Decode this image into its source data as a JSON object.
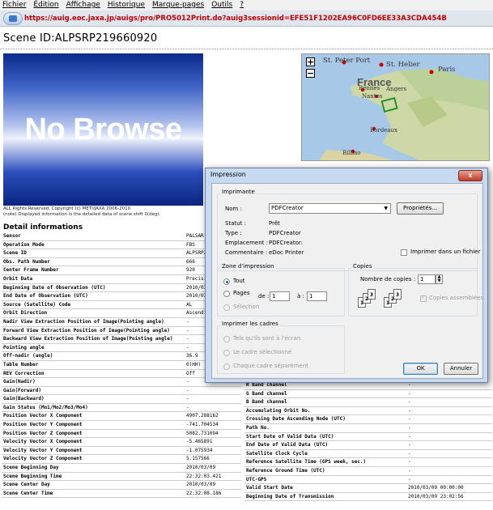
{
  "menu": [
    "Fichier",
    "Édition",
    "Affichage",
    "Historique",
    "Marque-pages",
    "Outils",
    "?"
  ],
  "url": "https://auig.eoc.jaxa.jp/auigs/pro/PRO5012Print.do?auig3sessionid=EFE51F1202EA96C0FD6EE33A3CDA454B",
  "scene_title": "Scene ID:ALPSRP219660920",
  "browse_text": "No Browse",
  "copyright": [
    "ALL Rights Reserved, Copyright (c) METI/JAXA 2006-2010",
    "(note) Displayed information is the detailed data of scene shift 0(deg)."
  ],
  "detail_heading": "Detail informations",
  "left_rows": [
    [
      "Sensor",
      "PALSAR"
    ],
    [
      "Operation Mode",
      "FBS"
    ],
    [
      "Scene ID",
      "ALPSRP2"
    ],
    [
      "Obs. Path Number",
      "666"
    ],
    [
      "Center Frame Number",
      "920"
    ],
    [
      "Orbit Data",
      "Precisi"
    ],
    [
      "Beginning Date of Observation (UTC)",
      "2010/03/"
    ],
    [
      "End Date of Observation (UTC)",
      "2010/03/"
    ],
    [
      "Source (Satellite) Code",
      "AL"
    ],
    [
      "Orbit Direction",
      "Ascendi"
    ],
    [
      "Nadir View Extraction Position of Image(Pointing angle)",
      "-"
    ],
    [
      "Forward View Extraction Position of Image(Pointing angle)",
      "-"
    ],
    [
      "Backward View Extraction Position of Image(Pointing angle)",
      "-"
    ],
    [
      "Pointing angle",
      "-"
    ],
    [
      "Off-nadir (angle)",
      "36.9"
    ],
    [
      "Table Number",
      "0(HH)"
    ],
    [
      "REV Correction",
      "Off"
    ],
    [
      "Gain(Nadir)",
      "-"
    ],
    [
      "Gain(Forward)",
      "-"
    ],
    [
      "Gain(Backward)",
      "-"
    ],
    [
      "Gain Status (Mo1/Mo2/Mo3/Mo4)",
      "-"
    ],
    [
      "Position Vector X Component",
      "4907.288162"
    ],
    [
      "Position Vector Y Component",
      "-741.704534"
    ],
    [
      "Position Vector Z Component",
      "5082.731094"
    ],
    [
      "Velocity Vector X Component",
      "-5.465891"
    ],
    [
      "Velocity Vector Y Component",
      "-1.075934"
    ],
    [
      "Velocity Vector Z Component",
      "5.157566"
    ],
    [
      "Scene Beginning Day",
      "2010/03/09"
    ],
    [
      "Scene Beginning Time",
      "22:32:03.421"
    ],
    [
      "Scene Center Day",
      "2010/03/09"
    ],
    [
      "Scene Center Time",
      "22:32:08.186"
    ]
  ],
  "right_rows": [
    [
      "R Band channel",
      "-"
    ],
    [
      "G Band channel",
      "-"
    ],
    [
      "B Band channel",
      "-"
    ],
    [
      "Accumulating Orbit No.",
      "-"
    ],
    [
      "Crossing Date Ascending Node (UTC)",
      "-"
    ],
    [
      "Path No.",
      "-"
    ],
    [
      "Start Date of Valid Data (UTC)",
      "-"
    ],
    [
      "End Date of Valid Data (UTC)",
      "-"
    ],
    [
      "Satellite Clock Cycle",
      "-"
    ],
    [
      "Reference Satellite Time (GPS week, sec.)",
      "-"
    ],
    [
      "Reference Ground Time (UTC)",
      "-"
    ],
    [
      "UTC-GPS",
      "-"
    ],
    [
      "Valid Start Date",
      "2010/03/09 00:00:00"
    ],
    [
      "Beginning Date of Transmission",
      "2010/03/09 23:02:56"
    ]
  ],
  "map": {
    "labels": [
      "St. Peter Port",
      "St. Helier",
      "Paris",
      "France",
      "Rennes",
      "Angers",
      "Nantes",
      "Bordeaux",
      "Bilbao"
    ],
    "zoom_in": "+",
    "zoom_out": "−"
  },
  "dialog": {
    "title": "Impression",
    "close": "x",
    "printer_group": "Imprimante",
    "name_label": "Nom :",
    "name_value": "PDFCreator",
    "props_button": "Propriétés...",
    "status_label": "Statut :",
    "status_value": "Prêt",
    "type_label": "Type :",
    "type_value": "PDFCreator",
    "location_label": "Emplacement :",
    "location_value": "PDFCreator:",
    "comment_label": "Commentaire :",
    "comment_value": "eDoc Printer",
    "print_to_file": "Imprimer dans un fichier",
    "range_group": "Zone d'impression",
    "all": "Tout",
    "pages": "Pages",
    "from": "de :",
    "from_val": "1",
    "to": "à :",
    "to_val": "1",
    "selection": "Sélection",
    "copies_group": "Copies",
    "copies_label": "Nombre de copies :",
    "copies_val": "1",
    "collate": "Copies assemblées",
    "frames_group": "Imprimer les cadres",
    "frames_1": "Tels qu'ils sont à l'écran",
    "frames_2": "Le cadre sélectionné",
    "frames_3": "Chaque cadre séparément",
    "ok": "OK",
    "cancel": "Annuler"
  }
}
